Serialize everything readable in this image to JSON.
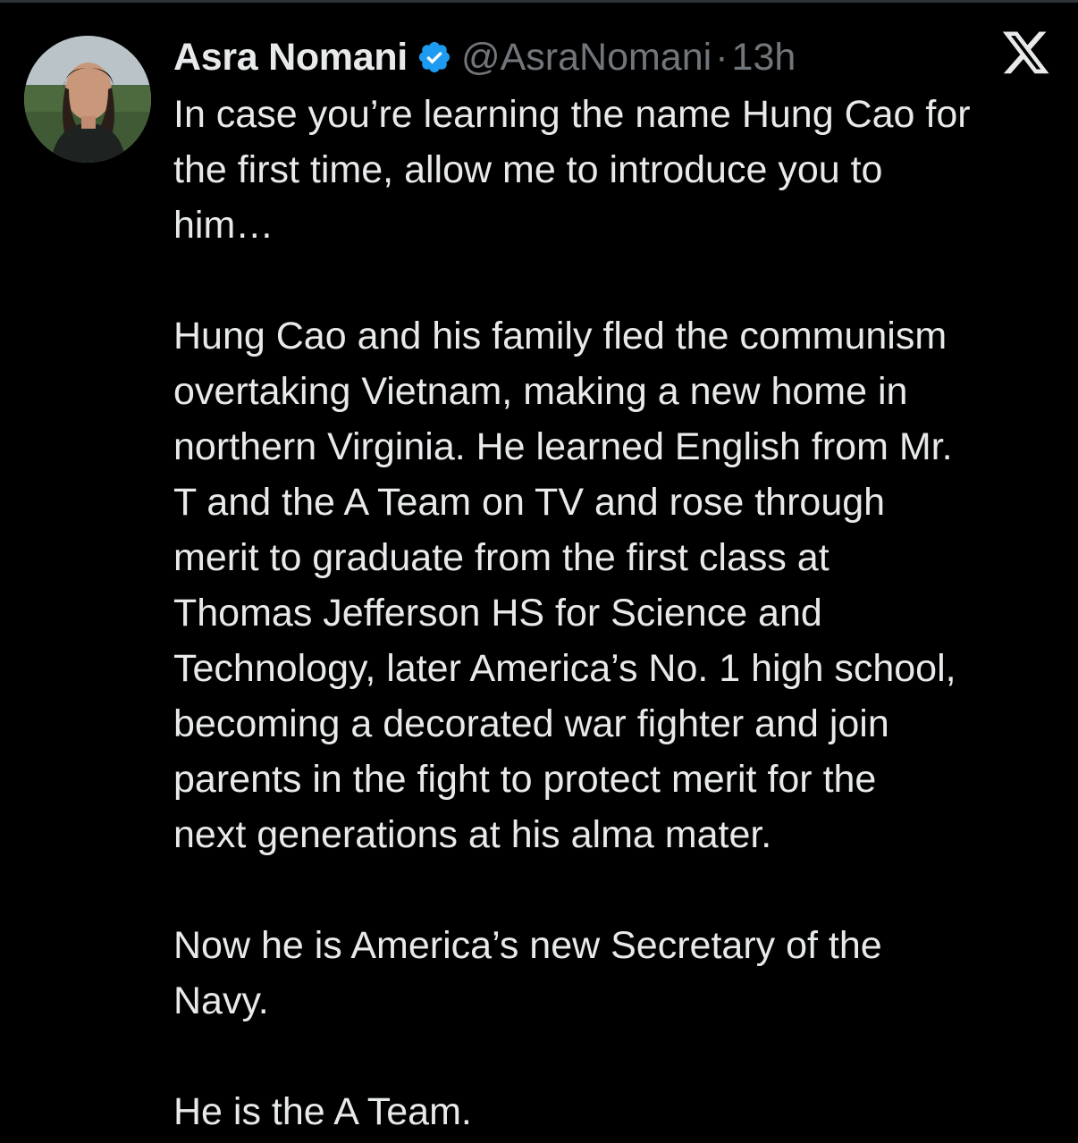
{
  "author": {
    "display_name": "Asra Nomani",
    "handle": "@AsraNomani",
    "separator": "·",
    "time": "13h",
    "verified": true
  },
  "icons": {
    "verified": "verified-badge-icon",
    "x_logo": "x-logo-icon"
  },
  "colors": {
    "background": "#000000",
    "text": "#e7e9ea",
    "muted": "#71767b",
    "verified": "#1d9bf0"
  },
  "tweet": {
    "paragraphs": [
      "In case you’re learning the name Hung Cao for\nthe first time, allow me to introduce you to\nhim…",
      "Hung Cao and his family fled the communism\novertaking Vietnam, making a new home in\nnorthern Virginia. He learned English from Mr.\nT and the A Team on TV and rose through\nmerit to graduate from the first class at\nThomas Jefferson HS for Science and\nTechnology, later America’s No. 1 high school,\nbecoming a decorated war fighter and join\nparents in the fight to protect merit for the\nnext generations at his alma mater.",
      "Now he is America’s new Secretary of the\nNavy.",
      "He is the A Team."
    ]
  }
}
